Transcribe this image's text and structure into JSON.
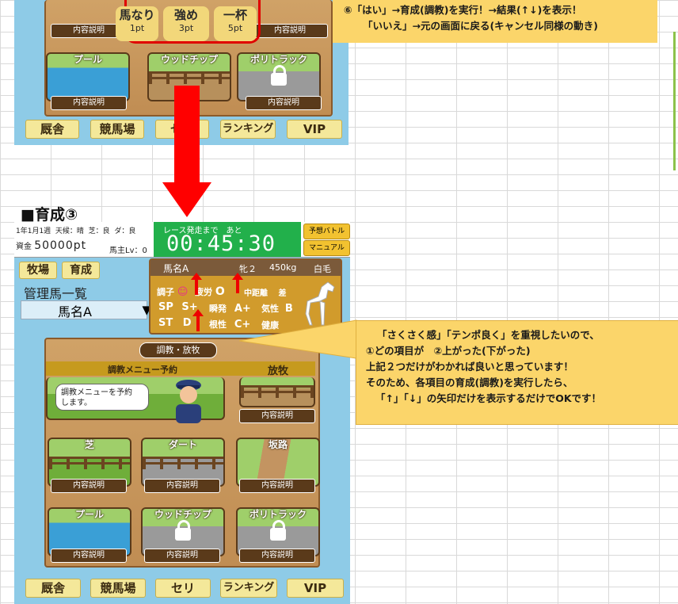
{
  "top": {
    "option_chips": [
      {
        "label": "馬なり",
        "pt": "1pt"
      },
      {
        "label": "強め",
        "pt": "3pt"
      },
      {
        "label": "一杯",
        "pt": "5pt"
      }
    ],
    "callout_lines": [
      "⑥「はい」→育成(調教)を実行！→結果(↑↓)を表示！",
      "「いいえ」→元の画面に戻る(キャンセル同様の動き)"
    ],
    "facility_tiles": [
      "プール",
      "ウッドチップ",
      "ポリトラック"
    ],
    "desc_label": "内容説明"
  },
  "section_title": "■育成③",
  "status": {
    "date": "1年1月1週",
    "weather": "天候：晴",
    "turf": "芝：良",
    "dirt": "ダ：良",
    "funds_label": "資金",
    "funds": "50000pt",
    "owner_level": "馬主Lv：0",
    "race_label": "レース発走まで　あと",
    "timer": "00:45:30",
    "btn_battle": "予想バトル",
    "btn_manual": "マニュアル"
  },
  "tabs": {
    "ranch": "牧場",
    "training": "育成"
  },
  "managed_title": "管理馬一覧",
  "horse_select": "馬名A",
  "horse_card": {
    "name": "馬名A",
    "sex_age": "牝２",
    "weight": "450kg",
    "color": "白毛",
    "condition_label": "調子",
    "fatigue_label": "疲労",
    "fatigue_value": "O",
    "distance": "中距離",
    "style": "差",
    "sp_label": "SP",
    "sp_value": "S+",
    "burst_label": "瞬発",
    "burst_value": "A+",
    "temper_label": "気性",
    "temper_value": "B",
    "st_label": "ST",
    "st_value": "D",
    "guts_label": "根性",
    "guts_value": "C+",
    "health_label": "健康"
  },
  "training": {
    "header": "調教・放牧",
    "menu_left": "調教メニュー予約",
    "menu_right": "放牧",
    "speech": "調教メニューを予約　します。",
    "tiles": [
      "芝",
      "ダート",
      "坂路",
      "プール",
      "ウッドチップ",
      "ポリトラック"
    ],
    "desc_label": "内容説明"
  },
  "callout2_lines": [
    "「さくさく感」「テンポ良く」を重視したいので、",
    "①どの項目が　②上がった(下がった)",
    "上記２つだけがわかれば良いと思っています！",
    "そのため、各項目の育成(調教)を実行したら、",
    "「↑」「↓」の矢印だけを表示するだけでOKです！"
  ],
  "nav": [
    "厩舎",
    "競馬場",
    "セリ",
    "ランキング",
    "VIP"
  ],
  "colors": {
    "arrow": "#ff0000",
    "callout": "#fbd56a",
    "status_green": "#22b04b",
    "sky": "#8ecbe7"
  }
}
